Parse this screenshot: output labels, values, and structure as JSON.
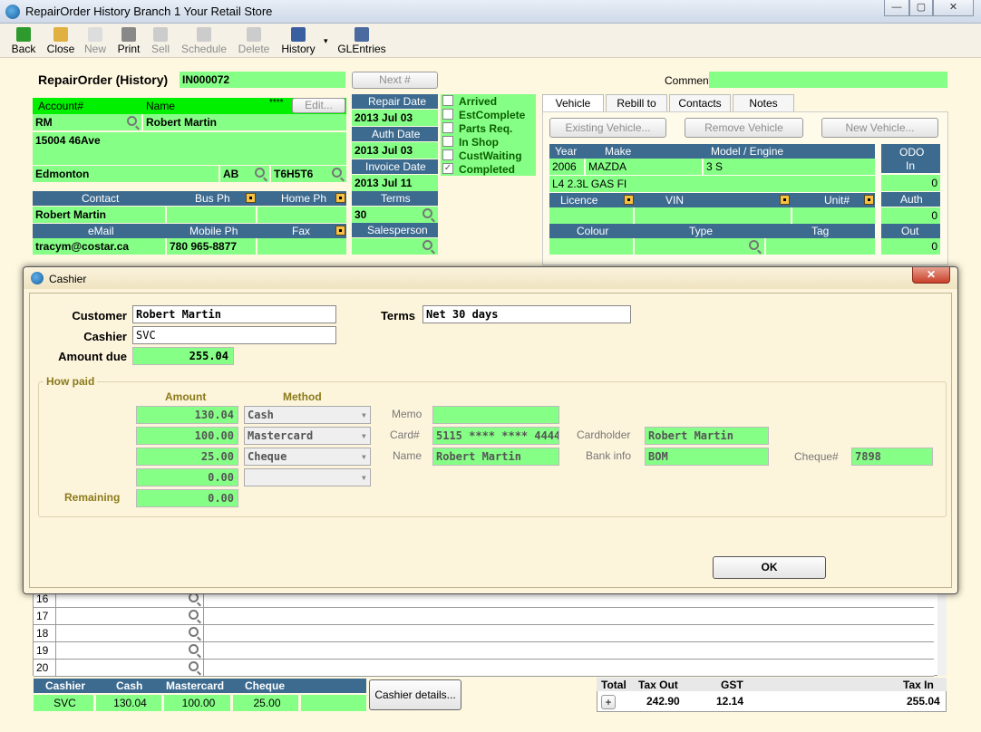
{
  "window": {
    "title": "RepairOrder  History  Branch 1  Your Retail Store"
  },
  "toolbar": {
    "back": "Back",
    "close": "Close",
    "new": "New",
    "print": "Print",
    "sell": "Sell",
    "schedule": "Schedule",
    "delete": "Delete",
    "history": "History",
    "glentries": "GLEntries"
  },
  "header": {
    "title": "RepairOrder (History)",
    "order_no": "IN000072",
    "next_btn": "Next #",
    "comment_label": "Comment",
    "comment": ""
  },
  "customer": {
    "account_label": "Account#",
    "name_label": "Name",
    "stars": "****",
    "edit_btn": "Edit...",
    "account": "RM",
    "name": "Robert Martin",
    "address1": "15004 46Ave",
    "address2": "",
    "city": "Edmonton",
    "province": "AB",
    "postal": "T6H5T6",
    "contact_label": "Contact",
    "busph_label": "Bus Ph",
    "homeph_label": "Home Ph",
    "contact": "Robert Martin",
    "busph": "",
    "homeph": "",
    "email_label": "eMail",
    "mobile_label": "Mobile Ph",
    "fax_label": "Fax",
    "email": "tracym@costar.ca",
    "mobile": "780 965-8877",
    "fax": ""
  },
  "dates": {
    "repair_label": "Repair Date",
    "repair": "2013 Jul 03",
    "auth_label": "Auth Date",
    "auth": "2013 Jul 03",
    "invoice_label": "Invoice Date",
    "invoice": "2013 Jul 11",
    "terms_label": "Terms",
    "terms": "30",
    "sales_label": "Salesperson",
    "sales": ""
  },
  "status": [
    {
      "label": "Arrived",
      "checked": false
    },
    {
      "label": "EstComplete",
      "checked": false
    },
    {
      "label": "Parts Req.",
      "checked": false
    },
    {
      "label": "In Shop",
      "checked": false
    },
    {
      "label": "CustWaiting",
      "checked": false
    },
    {
      "label": "Completed",
      "checked": true
    }
  ],
  "tabs": [
    "Vehicle",
    "Rebill to",
    "Contacts",
    "Notes"
  ],
  "vehicle": {
    "existing_btn": "Existing Vehicle...",
    "remove_btn": "Remove Vehicle",
    "new_btn": "New Vehicle...",
    "year_label": "Year",
    "make_label": "Make",
    "model_label": "Model / Engine",
    "year": "2006",
    "make": "MAZDA",
    "model": "3 S",
    "engine": "L4 2.3L  GAS FI",
    "licence_label": "Licence",
    "vin_label": "VIN",
    "unit_label": "Unit#",
    "colour_label": "Colour",
    "type_label": "Type",
    "tag_label": "Tag",
    "odo_label": "ODO",
    "in_label": "In",
    "odo_in": "0",
    "auth_label": "Auth",
    "auth": "0",
    "out_label": "Out",
    "out": "0"
  },
  "grid_rows": [
    "16",
    "17",
    "18",
    "19",
    "20"
  ],
  "cashier_summary": {
    "headers": [
      "Cashier",
      "Cash",
      "Mastercard",
      "Cheque"
    ],
    "values": [
      "SVC",
      "130.04",
      "100.00",
      "25.00"
    ],
    "details_btn": "Cashier details..."
  },
  "totals": {
    "total_label": "Total",
    "taxout_label": "Tax Out",
    "gst_label": "GST",
    "taxin_label": "Tax In",
    "plus": "+",
    "taxout": "242.90",
    "gst": "12.14",
    "taxin": "255.04"
  },
  "dialog": {
    "title": "Cashier",
    "customer_label": "Customer",
    "customer": "Robert Martin",
    "terms_label": "Terms",
    "terms": "Net 30 days",
    "cashier_label": "Cashier",
    "cashier": "SVC",
    "amount_due_label": "Amount due",
    "amount_due": "255.04",
    "how_paid": "How paid",
    "amount_header": "Amount",
    "method_header": "Method",
    "payments": [
      {
        "amount": "130.04",
        "method": "Cash"
      },
      {
        "amount": "100.00",
        "method": "Mastercard"
      },
      {
        "amount": "25.00",
        "method": "Cheque"
      },
      {
        "amount": "0.00",
        "method": ""
      }
    ],
    "remaining_label": "Remaining",
    "remaining": "0.00",
    "memo_label": "Memo",
    "memo": "",
    "card_label": "Card#",
    "card": "5115 **** **** 4444",
    "name_label": "Name",
    "name": "Robert Martin",
    "cardholder_label": "Cardholder",
    "cardholder": "Robert Martin",
    "bank_label": "Bank info",
    "bank": "BOM",
    "cheque_label": "Cheque#",
    "cheque": "7898",
    "ok": "OK"
  }
}
